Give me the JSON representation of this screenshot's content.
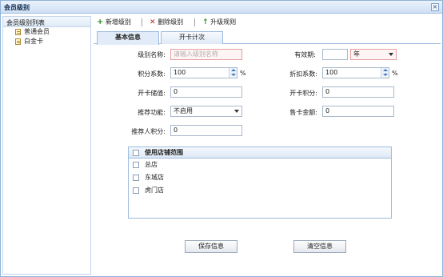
{
  "window": {
    "title": "会员级别"
  },
  "tree": {
    "header": "会员级别列表",
    "items": [
      {
        "label": "普通会员"
      },
      {
        "label": "白金卡"
      }
    ]
  },
  "toolbar": {
    "add_label": "新增级别",
    "delete_label": "删除级别",
    "upgrade_label": "升级规则"
  },
  "tabs": [
    {
      "label": "基本信息",
      "active": true
    },
    {
      "label": "开卡计次",
      "active": false
    }
  ],
  "form": {
    "level_name": {
      "label": "级别名称:",
      "placeholder": "请输入级别名称"
    },
    "validity": {
      "label": "有效期:",
      "value": "",
      "unit_value": "年"
    },
    "points_factor": {
      "label": "积分系数:",
      "value": "100",
      "unit": "%"
    },
    "discount_factor": {
      "label": "折扣系数:",
      "value": "100",
      "unit": "%"
    },
    "opening_fee": {
      "label": "开卡储值:",
      "value": "0"
    },
    "opening_points": {
      "label": "开卡积分:",
      "value": "0"
    },
    "referral": {
      "label": "推荐功能:",
      "value": "不启用"
    },
    "card_price": {
      "label": "售卡金额:",
      "value": "0"
    },
    "referrer_points": {
      "label": "推荐人积分:",
      "value": "0"
    }
  },
  "store_scope": {
    "header": "使用店铺范围",
    "stores": [
      {
        "label": "总店"
      },
      {
        "label": "东城店"
      },
      {
        "label": "虎门店"
      }
    ]
  },
  "buttons": {
    "save": "保存信息",
    "clear": "清空信息"
  },
  "colors": {
    "accent": "#9dbbe0",
    "required_border": "#e4a0a0"
  }
}
